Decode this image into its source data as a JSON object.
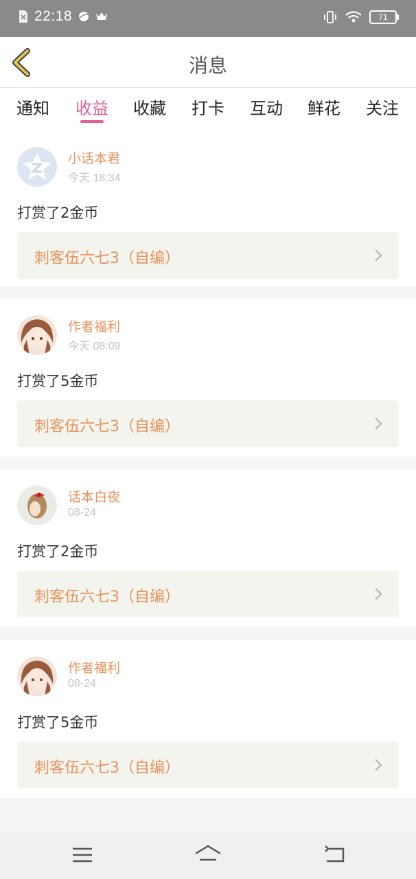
{
  "status_bar": {
    "time": "22:18",
    "battery": "71",
    "icons": [
      "sim-off-icon",
      "planet-icon",
      "crown-icon",
      "vibrate-icon",
      "wifi-icon",
      "battery-icon"
    ]
  },
  "header": {
    "title": "消息",
    "back_icon": "chevron-left-icon"
  },
  "tabs": [
    {
      "label": "通知",
      "active": false
    },
    {
      "label": "收益",
      "active": true
    },
    {
      "label": "收藏",
      "active": false
    },
    {
      "label": "打卡",
      "active": false
    },
    {
      "label": "互动",
      "active": false
    },
    {
      "label": "鲜花",
      "active": false
    },
    {
      "label": "关注",
      "active": false
    }
  ],
  "messages": [
    {
      "user": "小话本君",
      "time": "今天 18:34",
      "text": "打赏了2金币",
      "book": "刺客伍六七3（自编）",
      "avatar": "default-star-avatar"
    },
    {
      "user": "作者福利",
      "time": "今天 08:09",
      "text": "打赏了5金币",
      "book": "刺客伍六七3（自编）",
      "avatar": "anime-girl-avatar"
    },
    {
      "user": "话本白夜",
      "time": "08-24",
      "text": "打赏了2金币",
      "book": "刺客伍六七3（自编）",
      "avatar": "girl-bow-avatar"
    },
    {
      "user": "作者福利",
      "time": "08-24",
      "text": "打赏了5金币",
      "book": "刺客伍六七3（自编）",
      "avatar": "anime-girl-avatar"
    }
  ],
  "nav_bar": {
    "icons": [
      "menu-icon",
      "home-icon",
      "back-icon"
    ]
  },
  "colors": {
    "accent": "#e35e9b",
    "username": "#e8935c",
    "status_bar": "#8a8a8a",
    "back_arrow": "#d9b33a"
  }
}
